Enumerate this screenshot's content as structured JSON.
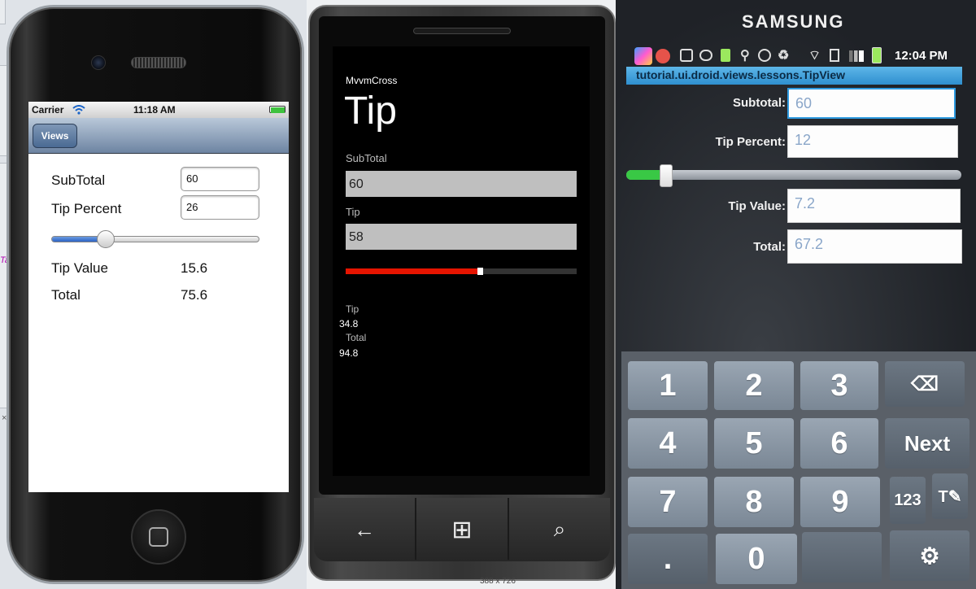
{
  "ios": {
    "status": {
      "carrier": "Carrier",
      "time": "11:18 AM"
    },
    "nav": {
      "back_label": "Views"
    },
    "form": {
      "subtotal_label": "SubTotal",
      "subtotal_value": "60",
      "tip_percent_label": "Tip Percent",
      "tip_percent_value": "26",
      "slider_value_percent": 26,
      "tip_value_label": "Tip Value",
      "tip_value": "15.6",
      "total_label": "Total",
      "total_value": "75.6"
    },
    "background_fragment_text": "Ta"
  },
  "wp": {
    "app_name": "MvvmCross",
    "page_title": "Tip",
    "subtotal_label": "SubTotal",
    "subtotal_value": "60",
    "tip_label": "Tip",
    "tip_value": "58",
    "slider_value_percent": 58,
    "slider_color": "#e51400",
    "result_tip_label": "Tip",
    "result_tip_value": "34.8",
    "result_total_label": "Total",
    "result_total_value": "94.8",
    "buttons": {
      "back": "←",
      "start": "⊞",
      "search": "⌕"
    },
    "footer_text": "388 x 726"
  },
  "android": {
    "brand": "SAMSUNG",
    "status_time": "12:04 PM",
    "title": "tutorial.ui.droid.views.lessons.TipView",
    "subtotal_label": "Subtotal:",
    "subtotal_value": "60",
    "tip_percent_label": "Tip Percent:",
    "tip_percent_value": "12",
    "slider_value_percent": 12,
    "slider_color": "#39c845",
    "tip_value_label": "Tip Value:",
    "tip_value": "7.2",
    "total_label": "Total:",
    "total_value": "67.2",
    "keypad": {
      "k1": "1",
      "k2": "2",
      "k3": "3",
      "backspace": "⌫",
      "k4": "4",
      "k5": "5",
      "k6": "6",
      "next": "Next",
      "k7": "7",
      "k8": "8",
      "k9": "9",
      "sym": "123",
      "tool": "T✎",
      "dot": ".",
      "k0": "0",
      "settings": "⚙"
    }
  }
}
